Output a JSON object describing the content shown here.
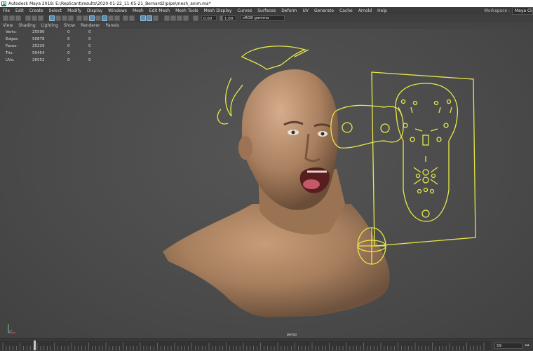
{
  "window": {
    "logo": "M",
    "title": "Autodesk Maya 2018: E:\\Replicant\\results\\2020-01-22_11-05-21_Bernard2\\pipe\\mesh_anim.ma*"
  },
  "menubar": {
    "items": [
      "File",
      "Edit",
      "Create",
      "Select",
      "Modify",
      "Display",
      "Windows",
      "Mesh",
      "Edit Mesh",
      "Mesh Tools",
      "Mesh Display",
      "Curves",
      "Surfaces",
      "Deform",
      "UV",
      "Generate",
      "Cache",
      "Arnold",
      "Help"
    ],
    "workspace_label": "Workspace :",
    "workspace_value": "Maya Classic"
  },
  "status_line": {
    "field1": "0.00",
    "field2": "1.00",
    "colorspace": "sRGB gamma"
  },
  "panel_menu": {
    "items": [
      "View",
      "Shading",
      "Lighting",
      "Show",
      "Renderer",
      "Panels"
    ]
  },
  "hud": {
    "rows": [
      {
        "label": "Verts:",
        "value": "25590",
        "c2": "0",
        "c3": "0"
      },
      {
        "label": "Edges:",
        "value": "50878",
        "c2": "0",
        "c3": "0"
      },
      {
        "label": "Faces:",
        "value": "25229",
        "c2": "0",
        "c3": "0"
      },
      {
        "label": "Tris:",
        "value": "50454",
        "c2": "0",
        "c3": "0"
      },
      {
        "label": "UVs:",
        "value": "26552",
        "c2": "0",
        "c3": "0"
      }
    ]
  },
  "viewport": {
    "camera": "persp",
    "subject": "3d-head-bust",
    "rig_color": "#e8e84a",
    "skin_color": "#b08a66"
  },
  "timeline": {
    "current_frame": "59",
    "skip_icon": "step-back-icon"
  }
}
